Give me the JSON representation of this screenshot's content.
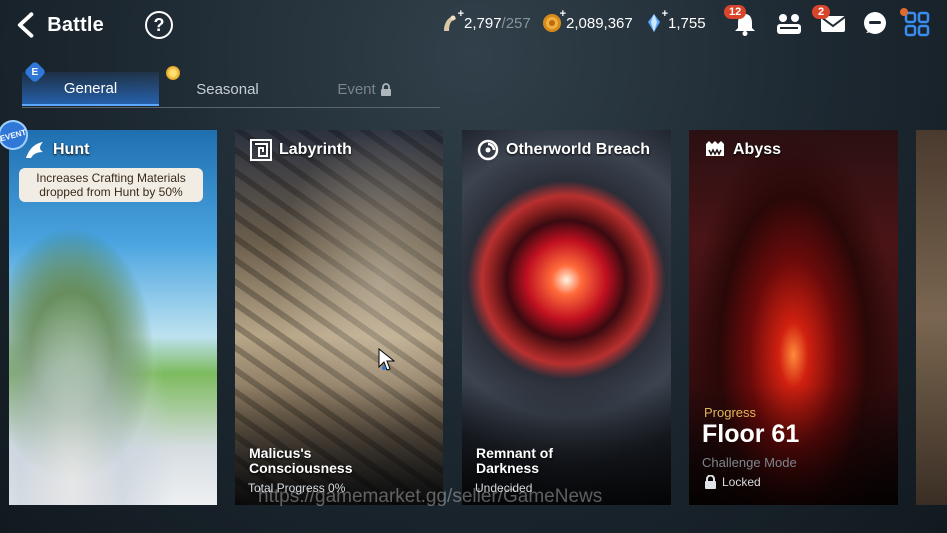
{
  "header": {
    "back_label": "Battle",
    "help_icon": "question-circle-icon",
    "resources": {
      "stamina": {
        "value": "2,797",
        "max": "/257"
      },
      "gold": {
        "value": "2,089,367"
      },
      "skystone": {
        "value": "1,755"
      }
    },
    "icons": {
      "notifications_badge": "12",
      "mail_badge": "2"
    }
  },
  "tabs": [
    {
      "label": "General",
      "active": true
    },
    {
      "label": "Seasonal",
      "active": false
    },
    {
      "label": "Event",
      "active": false,
      "locked": true
    }
  ],
  "event_tag": "EVENT",
  "tab_e_badge": "E",
  "cards": {
    "hunt": {
      "title": "Hunt",
      "banner": "Increases Crafting Materials dropped from Hunt by 50%"
    },
    "labyrinth": {
      "title": "Labyrinth",
      "subtitle": "Malicus's Consciousness",
      "status": "Total Progress 0%"
    },
    "breach": {
      "title": "Otherworld Breach",
      "subtitle": "Remnant of Darkness",
      "status": "Undecided"
    },
    "abyss": {
      "title": "Abyss",
      "progress_label": "Progress",
      "floor": "Floor 61",
      "mode": "Challenge Mode",
      "lock_status": "Locked"
    }
  },
  "watermark": "https://gamemarket.gg/seller/GameNews",
  "colors": {
    "active_tab": "#2f78d8",
    "progress_gold": "#e0b65a",
    "badge_red": "#d9452b"
  }
}
